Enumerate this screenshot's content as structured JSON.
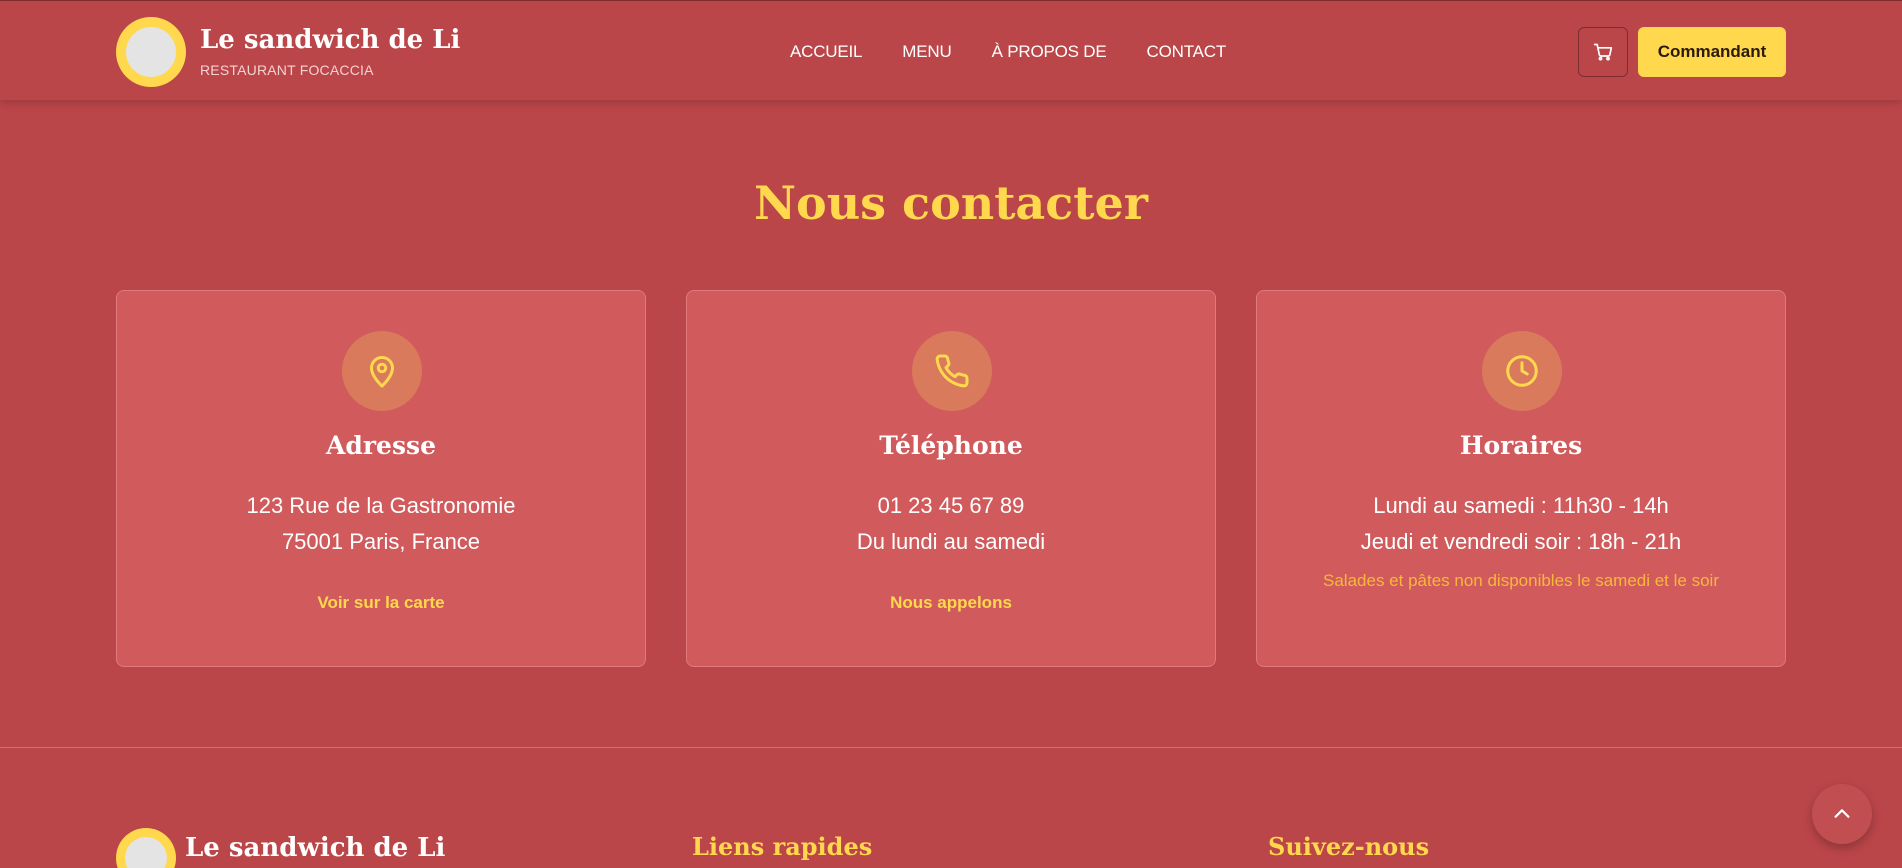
{
  "header": {
    "brand_name": "Le sandwich de Li",
    "brand_sub": "RESTAURANT FOCACCIA",
    "nav": [
      "ACCUEIL",
      "MENU",
      "À PROPOS DE",
      "CONTACT"
    ],
    "order_label": "Commandant",
    "cart_icon": "cart-icon"
  },
  "contact": {
    "title": "Nous contacter",
    "cards": [
      {
        "icon": "map-pin-icon",
        "title": "Adresse",
        "lines": [
          "123 Rue de la Gastronomie",
          "75001 Paris, France"
        ],
        "link": "Voir sur la carte"
      },
      {
        "icon": "phone-icon",
        "title": "Téléphone",
        "lines": [
          "01 23 45 67 89",
          "Du lundi au samedi"
        ],
        "link": "Nous appelons"
      },
      {
        "icon": "clock-icon",
        "title": "Horaires",
        "lines": [
          "Lundi au samedi : 11h30 - 14h",
          "Jeudi et vendredi soir : 18h - 21h"
        ],
        "note": "Salades et pâtes non disponibles le samedi et le soir"
      }
    ]
  },
  "footer": {
    "brand_name": "Le sandwich de Li",
    "quick_links_title": "Liens rapides",
    "follow_title": "Suivez-nous"
  },
  "colors": {
    "background": "#bb4649",
    "card": "#d05a5c",
    "accent": "#ffd84d",
    "note": "#f7b83a"
  }
}
